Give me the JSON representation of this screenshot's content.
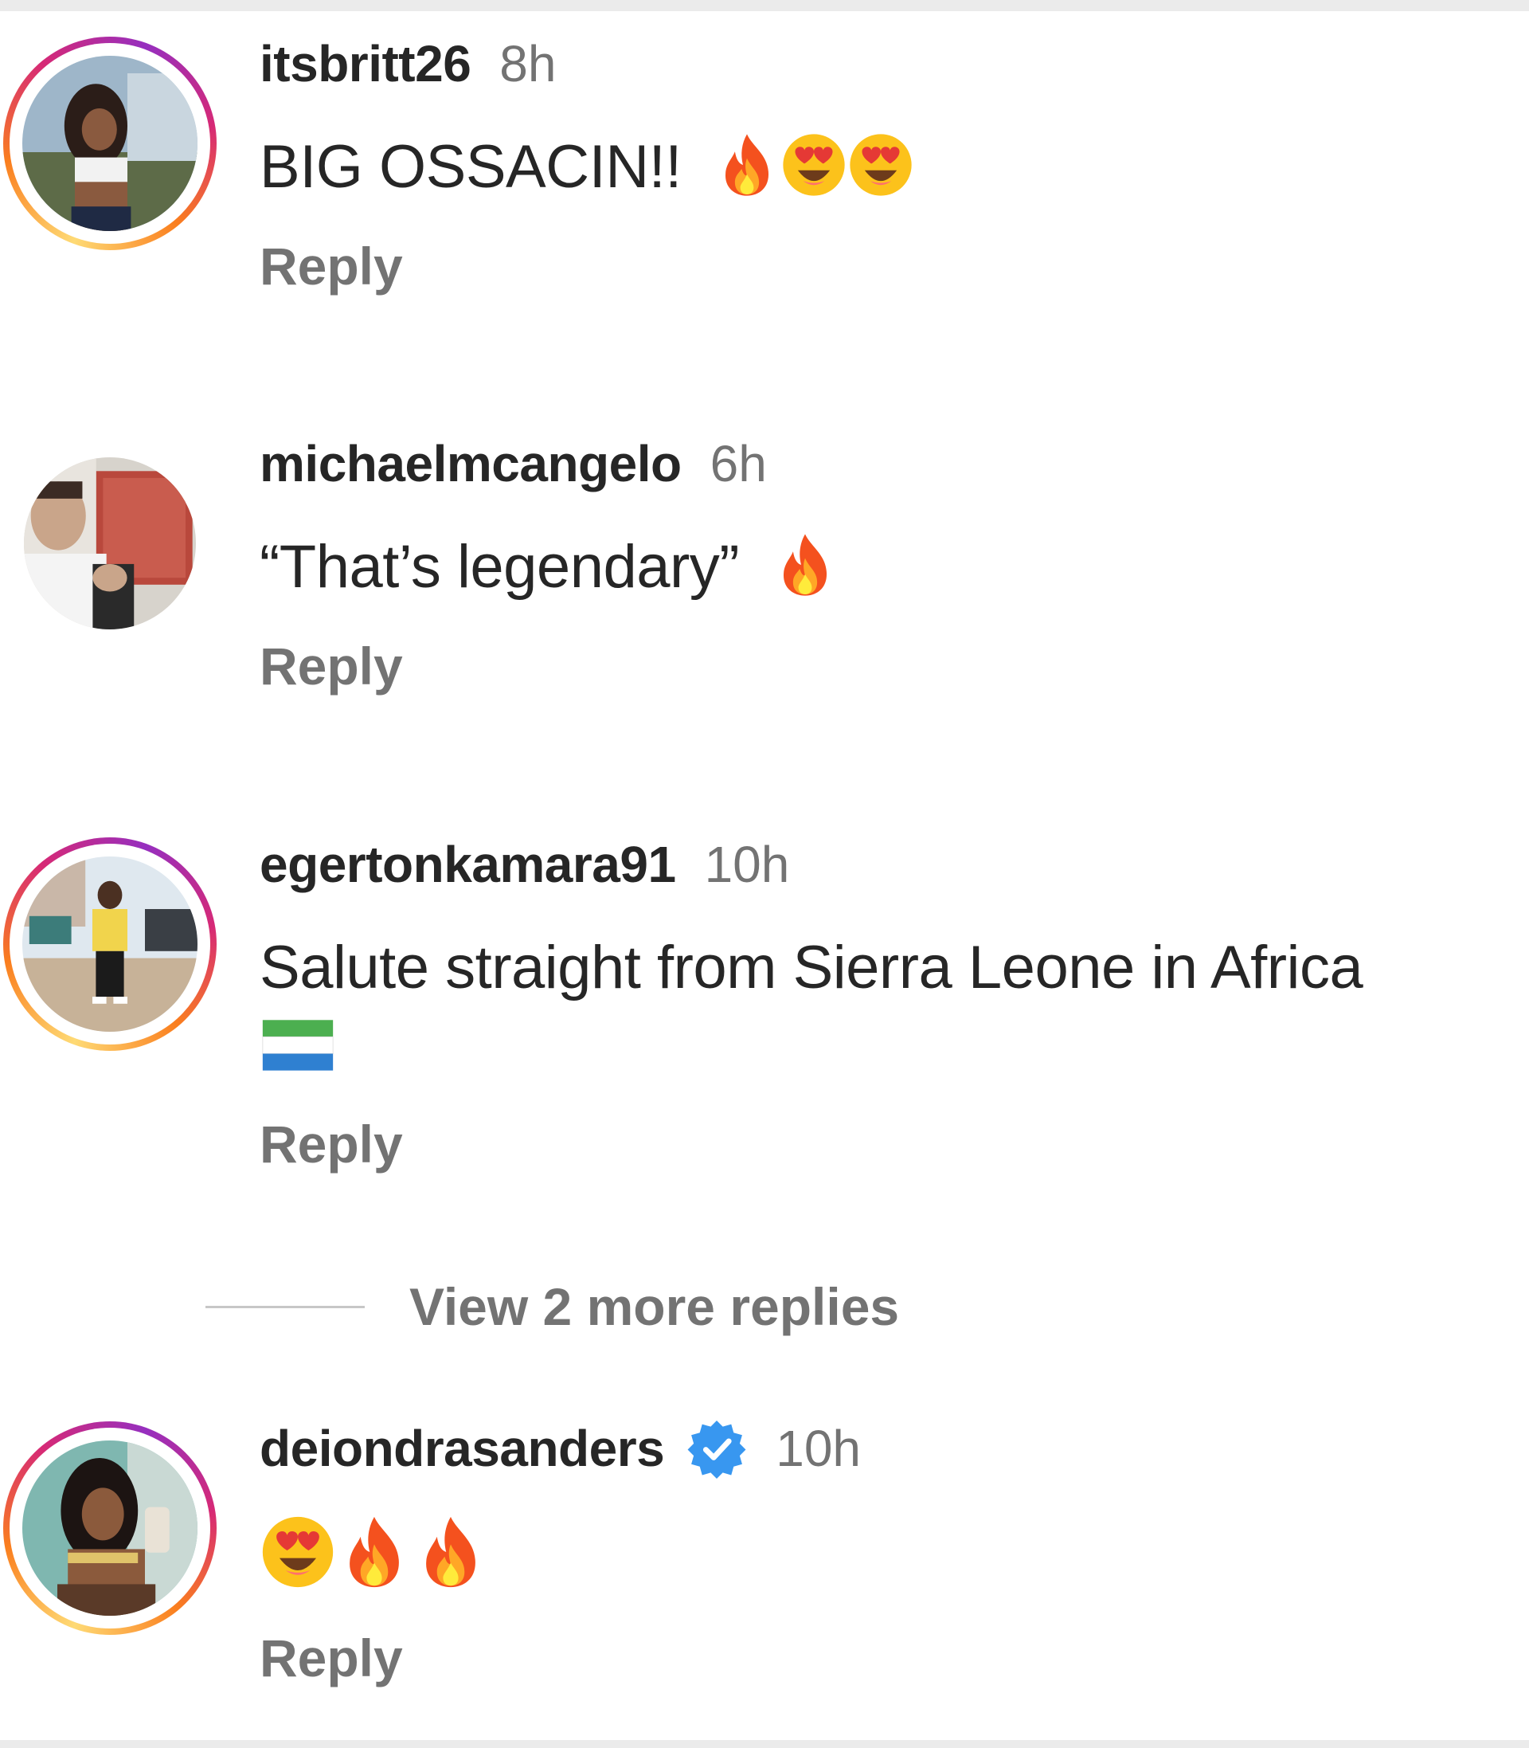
{
  "comments": [
    {
      "username": "itsbritt26",
      "time": "8h",
      "text": "BIG OSSACIN!!",
      "emojis": [
        "fire-emoji",
        "heart-eyes-emoji",
        "heart-eyes-emoji"
      ],
      "reply_label": "Reply",
      "story_ring": true,
      "verified": false
    },
    {
      "username": "michaelmcangelo",
      "time": "6h",
      "text": "“That’s legendary”",
      "emojis": [
        "fire-emoji"
      ],
      "reply_label": "Reply",
      "story_ring": false,
      "verified": false
    },
    {
      "username": "egertonkamara91",
      "time": "10h",
      "text": "Salute straight from Sierra Leone in Africa",
      "emojis": [
        "sierra-leone-flag-emoji"
      ],
      "reply_label": "Reply",
      "story_ring": true,
      "verified": false,
      "view_more_replies": "View 2 more replies"
    },
    {
      "username": "deiondrasanders",
      "time": "10h",
      "text": "",
      "emojis": [
        "heart-eyes-emoji",
        "fire-emoji",
        "fire-emoji"
      ],
      "reply_label": "Reply",
      "story_ring": true,
      "verified": true
    }
  ],
  "colors": {
    "text_primary": "#262626",
    "text_secondary": "#737373",
    "verified_blue": "#3897f0",
    "ring_gradient": [
      "#feda75",
      "#fa7e1e",
      "#d62976",
      "#962fbf"
    ]
  }
}
